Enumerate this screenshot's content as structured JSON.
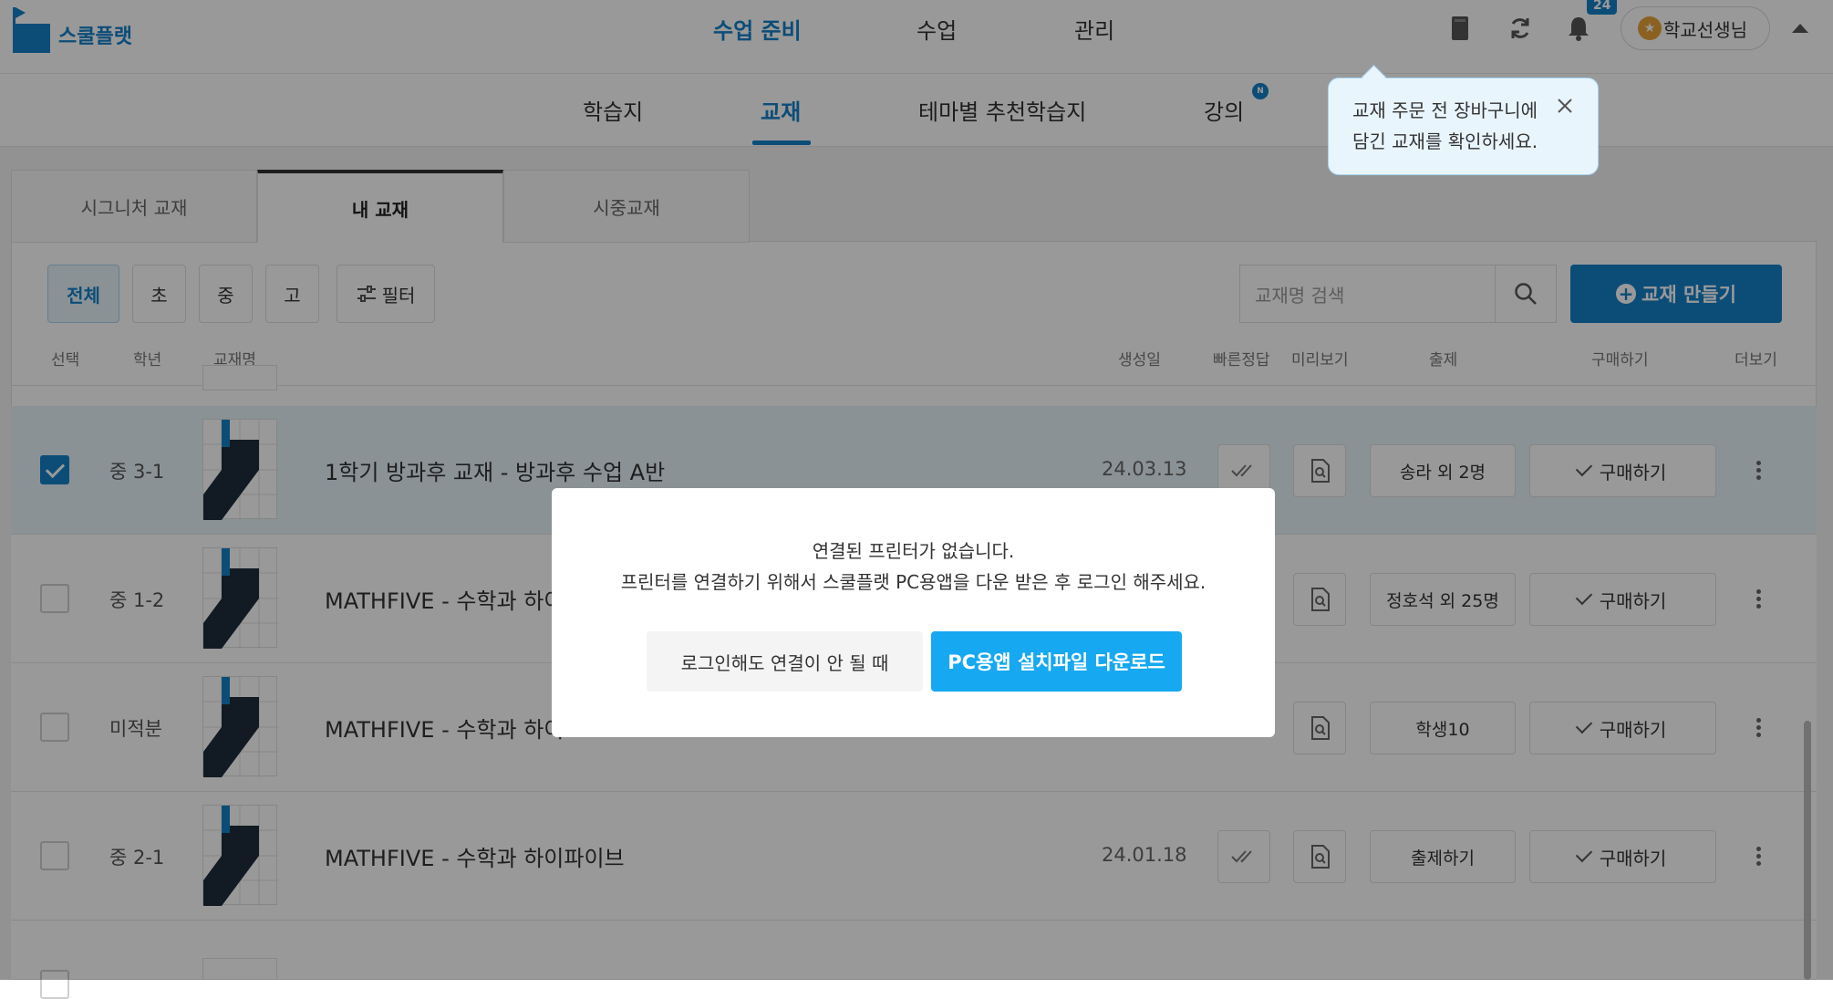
{
  "header": {
    "logo_text": "스쿨플랫",
    "nav": [
      "수업 준비",
      "수업",
      "관리"
    ],
    "notification_count": "24",
    "user_name": "학교선생님"
  },
  "subnav": {
    "tabs": [
      "학습지",
      "교재",
      "테마별 추천학습지",
      "강의"
    ],
    "new_badge": "N"
  },
  "tooltip": {
    "line1": "교재 주문 전 장바구니에",
    "line2": "담긴 교재를 확인하세요."
  },
  "content_tabs": [
    "시그니처 교재",
    "내 교재",
    "시중교재"
  ],
  "filters": [
    "전체",
    "초",
    "중",
    "고"
  ],
  "filter_label": "필터",
  "search": {
    "placeholder": "교재명 검색"
  },
  "make_button": "교재 만들기",
  "columns": [
    "선택",
    "학년",
    "교재명",
    "생성일",
    "빠른정답",
    "미리보기",
    "출제",
    "구매하기",
    "더보기"
  ],
  "rows": [
    {
      "grade": "중 3-1",
      "name": "1학기 방과후 교재 - 방과후 수업 A반",
      "date": "24.03.13",
      "assign": "송라 외 2명",
      "buy": "구매하기",
      "checked": true
    },
    {
      "grade": "중 1-2",
      "name": "MATHFIVE - 수학과 하이",
      "date": "",
      "assign": "정호석 외 25명",
      "buy": "구매하기",
      "checked": false
    },
    {
      "grade": "미적분",
      "name": "MATHFIVE - 수학과 하이",
      "date": "",
      "assign": "학생10",
      "buy": "구매하기",
      "checked": false
    },
    {
      "grade": "중 2-1",
      "name": "MATHFIVE - 수학과 하이파이브",
      "date": "24.01.18",
      "assign": "출제하기",
      "buy": "구매하기",
      "checked": false
    }
  ],
  "modal": {
    "line1": "연결된 프린터가 없습니다.",
    "line2": "프린터를 연결하기 위해서 스쿨플랫 PC용앱을 다운 받은 후 로그인 해주세요.",
    "secondary_button": "로그인해도 연결이 안 될 때",
    "primary_button": "PC용앱 설치파일 다운로드"
  },
  "colors": {
    "accent": "#1581c9",
    "primary_button": "#16a8f1",
    "selected_row": "#e6f3fb"
  }
}
